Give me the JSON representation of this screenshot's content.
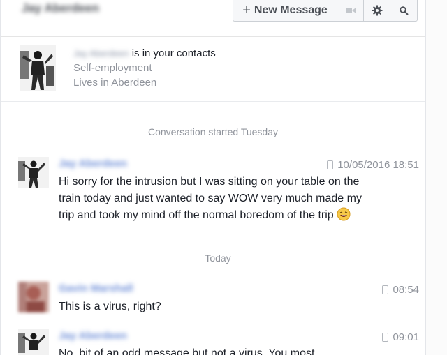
{
  "header": {
    "contact_name": "Jay Aberdeen",
    "new_message_label": "New Message",
    "icons": [
      "video-call-icon",
      "gear-icon",
      "search-icon"
    ]
  },
  "contact_card": {
    "name": "Jay Aberdeen",
    "in_contacts_text": "is in your contacts",
    "work": "Self-employment",
    "location": "Lives in Aberdeen"
  },
  "conversation_started": "Conversation started Tuesday",
  "messages": [
    {
      "sender": "Jay Aberdeen",
      "time": "10/05/2016 18:51",
      "text": "Hi sorry for the intrusion but I was sitting on your table on the train today and just wanted to say WOW very much made my trip and took my mind off the normal boredom of the trip"
    },
    {
      "sender": "Gavin Marshall",
      "time": "08:54",
      "text": "This is a virus, right?"
    },
    {
      "sender": "Jay Aberdeen",
      "time": "09:01",
      "text": "No, bit of an odd message but not a virus. You most"
    }
  ],
  "today_divider": "Today",
  "colors": {
    "name_blue": "#6f8fd8",
    "meta_gray": "#90949c",
    "text": "#1d2129"
  }
}
